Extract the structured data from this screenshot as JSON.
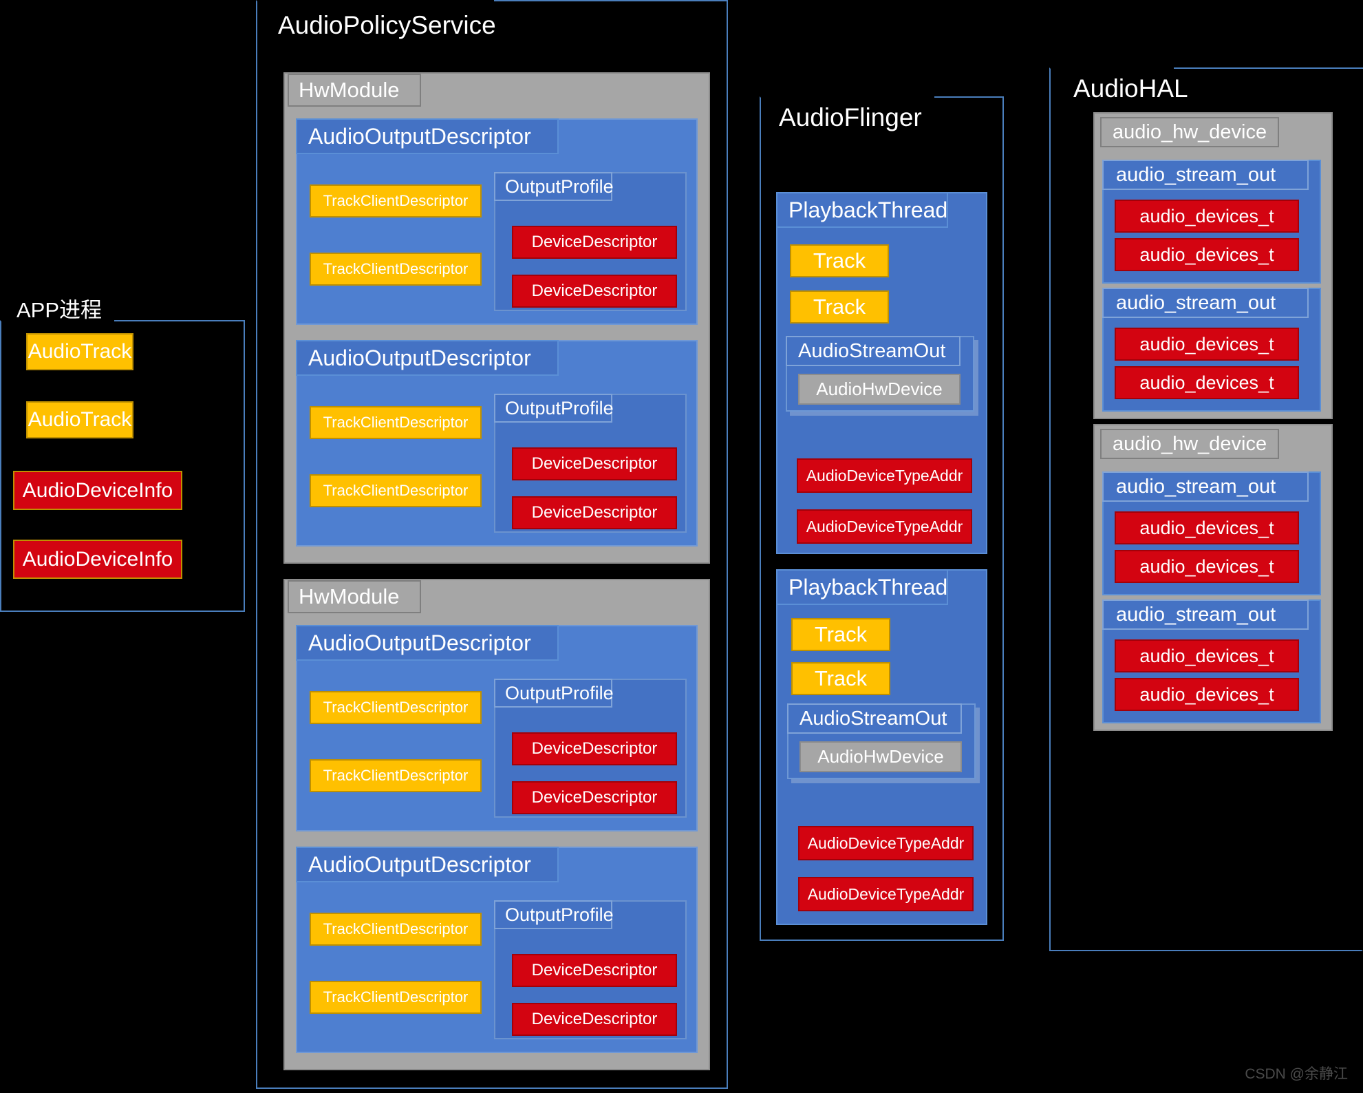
{
  "diagram": {
    "title_app": "APP进程",
    "title_aps": "AudioPolicyService",
    "title_af": "AudioFlinger",
    "title_hal": "AudioHAL",
    "watermark": "CSDN @余静江",
    "colors": {
      "background": "#000000",
      "frame_border": "#4a7ebc",
      "gray_panel": "#a6a6a6",
      "blue_box": "#4472c4",
      "gold_box": "#ffc000",
      "red_box": "#d30411"
    }
  },
  "app_process": {
    "title": "APP进程",
    "items": [
      {
        "label": "AudioTrack",
        "kind": "gold"
      },
      {
        "label": "AudioTrack",
        "kind": "gold"
      },
      {
        "label": "AudioDeviceInfo",
        "kind": "red"
      },
      {
        "label": "AudioDeviceInfo",
        "kind": "red"
      }
    ]
  },
  "audio_policy_service": {
    "title": "AudioPolicyService",
    "hw_modules": [
      {
        "label": "HwModule",
        "output_descriptors": [
          {
            "label": "AudioOutputDescriptor",
            "track_clients": [
              "TrackClientDescriptor",
              "TrackClientDescriptor"
            ],
            "output_profile": {
              "label": "OutputProfile",
              "device_descriptors": [
                "DeviceDescriptor",
                "DeviceDescriptor"
              ]
            }
          },
          {
            "label": "AudioOutputDescriptor",
            "track_clients": [
              "TrackClientDescriptor",
              "TrackClientDescriptor"
            ],
            "output_profile": {
              "label": "OutputProfile",
              "device_descriptors": [
                "DeviceDescriptor",
                "DeviceDescriptor"
              ]
            }
          }
        ]
      },
      {
        "label": "HwModule",
        "output_descriptors": [
          {
            "label": "AudioOutputDescriptor",
            "track_clients": [
              "TrackClientDescriptor",
              "TrackClientDescriptor"
            ],
            "output_profile": {
              "label": "OutputProfile",
              "device_descriptors": [
                "DeviceDescriptor",
                "DeviceDescriptor"
              ]
            }
          },
          {
            "label": "AudioOutputDescriptor",
            "track_clients": [
              "TrackClientDescriptor",
              "TrackClientDescriptor"
            ],
            "output_profile": {
              "label": "OutputProfile",
              "device_descriptors": [
                "DeviceDescriptor",
                "DeviceDescriptor"
              ]
            }
          }
        ]
      }
    ]
  },
  "audio_flinger": {
    "title": "AudioFlinger",
    "playback_threads": [
      {
        "label": "PlaybackThread",
        "tracks": [
          "Track",
          "Track"
        ],
        "audio_stream_out": {
          "label": "AudioStreamOut",
          "hw_device": "AudioHwDevice"
        },
        "device_type_addrs": [
          "AudioDeviceTypeAddr",
          "AudioDeviceTypeAddr"
        ]
      },
      {
        "label": "PlaybackThread",
        "tracks": [
          "Track",
          "Track"
        ],
        "audio_stream_out": {
          "label": "AudioStreamOut",
          "hw_device": "AudioHwDevice"
        },
        "device_type_addrs": [
          "AudioDeviceTypeAddr",
          "AudioDeviceTypeAddr"
        ]
      }
    ]
  },
  "audio_hal": {
    "title": "AudioHAL",
    "hw_devices": [
      {
        "label": "audio_hw_device",
        "streams": [
          {
            "label": "audio_stream_out",
            "devices": [
              "audio_devices_t",
              "audio_devices_t"
            ]
          },
          {
            "label": "audio_stream_out",
            "devices": [
              "audio_devices_t",
              "audio_devices_t"
            ]
          }
        ]
      },
      {
        "label": "audio_hw_device",
        "streams": [
          {
            "label": "audio_stream_out",
            "devices": [
              "audio_devices_t",
              "audio_devices_t"
            ]
          },
          {
            "label": "audio_stream_out",
            "devices": [
              "audio_devices_t",
              "audio_devices_t"
            ]
          }
        ]
      }
    ]
  }
}
